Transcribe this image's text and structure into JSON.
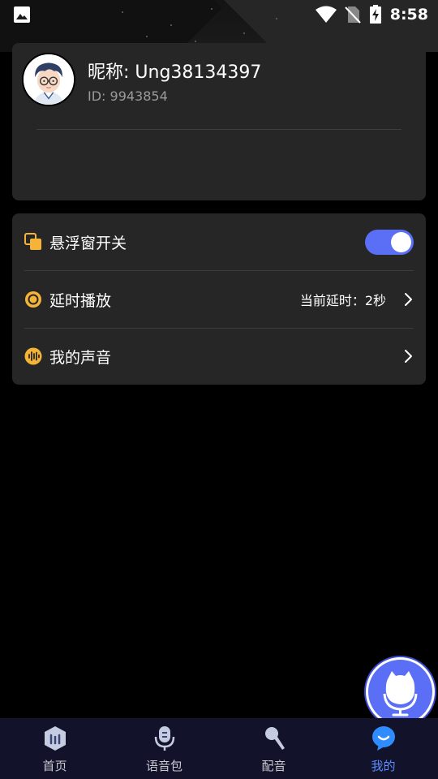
{
  "status_bar": {
    "time": "8:58",
    "icons": [
      "image-icon",
      "wifi-icon",
      "no-sim-icon",
      "battery-charging-icon"
    ]
  },
  "profile": {
    "nickname": "昵称: Ung38134397",
    "user_id": "ID: 9943854",
    "avatar": "avatar-cartoon-boy-glasses"
  },
  "settings": {
    "items": [
      {
        "label": "悬浮窗开关",
        "icon": "floating-window-icon",
        "toggle_on": true
      },
      {
        "label": "延时播放",
        "icon": "delay-icon",
        "value": "当前延时：2秒"
      },
      {
        "label": "我的声音",
        "icon": "voice-wave-icon"
      }
    ]
  },
  "fab": {
    "icon": "microphone-mascot-icon"
  },
  "bottom_nav": {
    "items": [
      {
        "label": "首页",
        "icon": "home-icon",
        "active": false
      },
      {
        "label": "语音包",
        "icon": "voice-pack-icon",
        "active": false
      },
      {
        "label": "配音",
        "icon": "dubbing-mic-icon",
        "active": false
      },
      {
        "label": "我的",
        "icon": "profile-icon",
        "active": true
      }
    ]
  },
  "colors": {
    "accent": "#5a6ef6",
    "card": "#262626",
    "icon_yellow": "#f5b437",
    "nav_bg": "#12122a",
    "nav_active": "#5a8cff"
  }
}
